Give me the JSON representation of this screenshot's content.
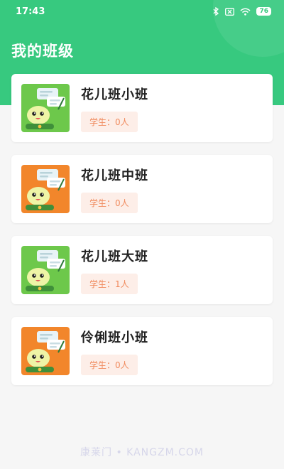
{
  "status_bar": {
    "time": "17:43",
    "battery": "76",
    "icons": [
      "bluetooth-icon",
      "sim-icon",
      "wifi-icon",
      "battery-icon"
    ]
  },
  "page": {
    "title": "我的班级"
  },
  "colors": {
    "header": "#37c97f",
    "badge_bg": "#fdeee8",
    "badge_text": "#f08a5d"
  },
  "classes": [
    {
      "name": "花儿班小班",
      "students": "学生：0人",
      "avatar_bg": "#6dc84b"
    },
    {
      "name": "花儿班中班",
      "students": "学生：0人",
      "avatar_bg": "#f2862b"
    },
    {
      "name": "花儿班大班",
      "students": "学生：1人",
      "avatar_bg": "#6dc84b"
    },
    {
      "name": "伶俐班小班",
      "students": "学生：0人",
      "avatar_bg": "#f2862b"
    }
  ],
  "watermark": "康莱门 • KANGZM.COM"
}
